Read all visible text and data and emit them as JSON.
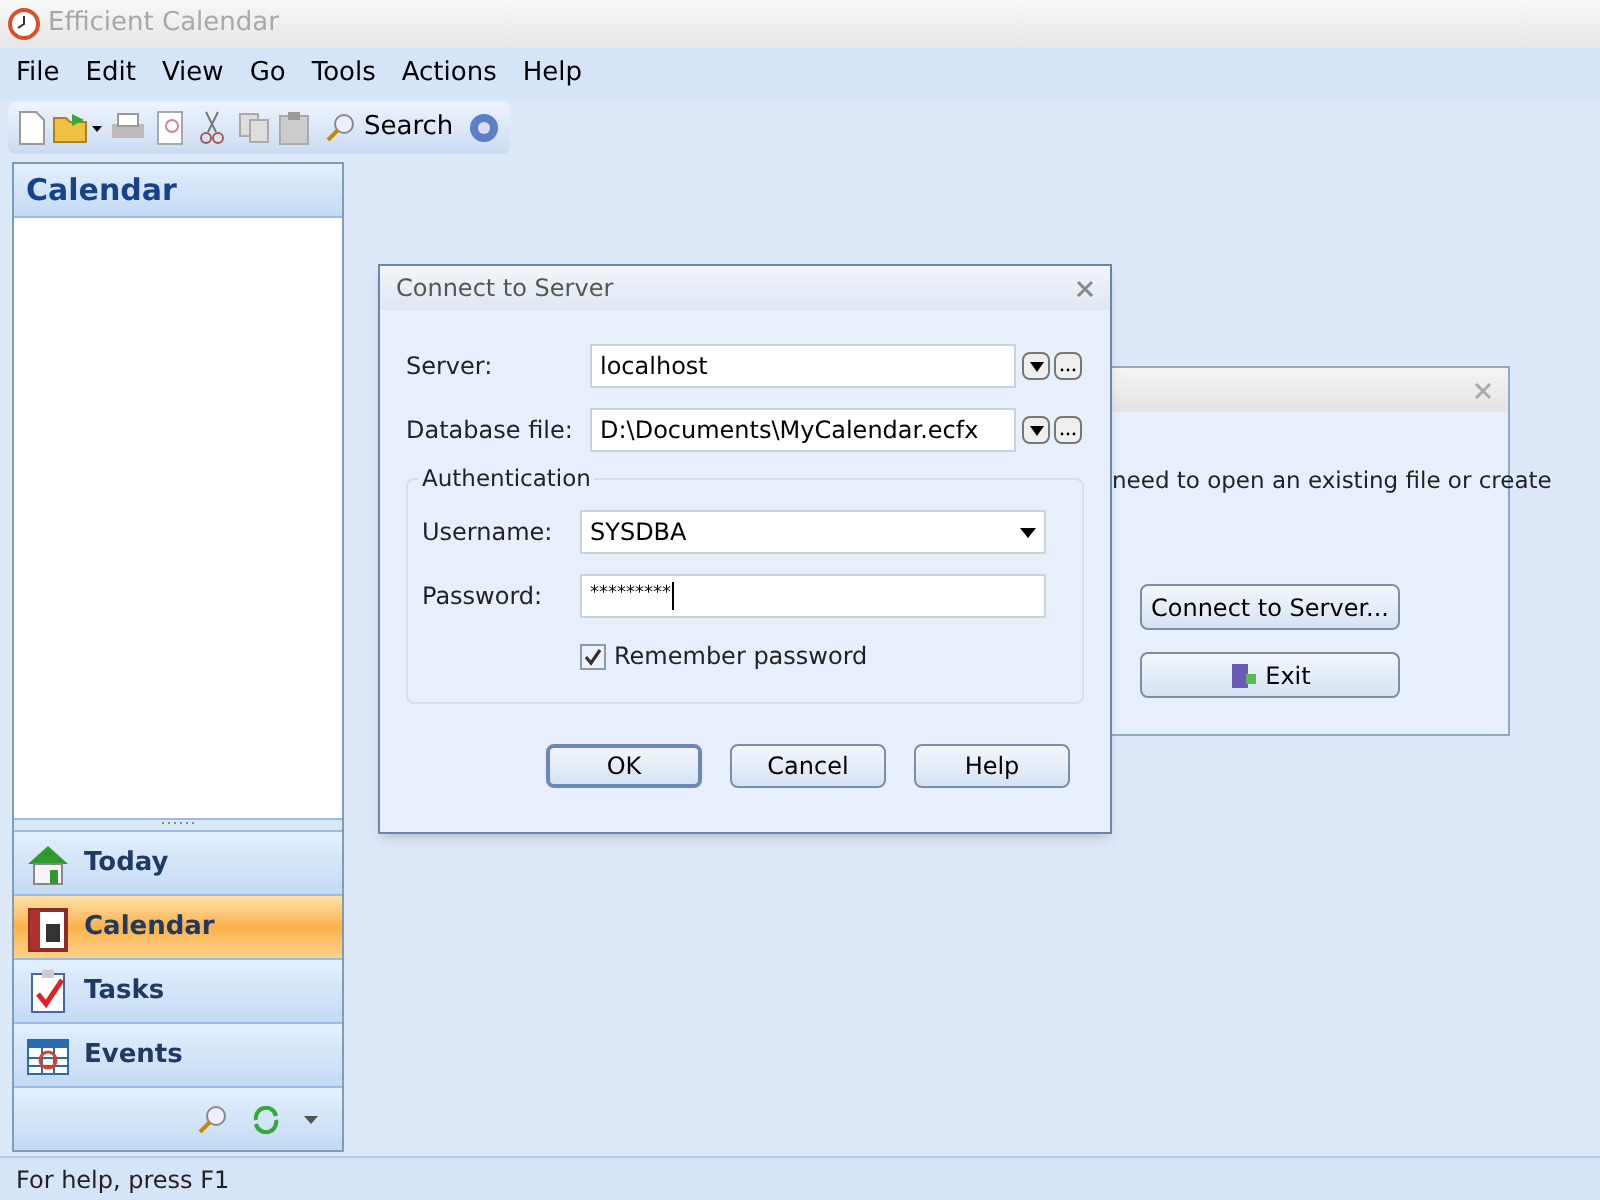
{
  "window": {
    "title": "Efficient Calendar"
  },
  "menu": [
    "File",
    "Edit",
    "View",
    "Go",
    "Tools",
    "Actions",
    "Help"
  ],
  "toolbar": {
    "search_label": "Search"
  },
  "sidebar": {
    "title": "Calendar",
    "nav": [
      {
        "label": "Today",
        "kind": "today",
        "selected": false
      },
      {
        "label": "Calendar",
        "kind": "calendar",
        "selected": true
      },
      {
        "label": "Tasks",
        "kind": "tasks",
        "selected": false
      },
      {
        "label": "Events",
        "kind": "events",
        "selected": false
      }
    ]
  },
  "back_dialog": {
    "text": "need to open an existing file or create",
    "buttons": [
      {
        "label": "Connect to Server...",
        "kind": "plain"
      },
      {
        "label": "Exit",
        "kind": "exit"
      }
    ]
  },
  "dialog": {
    "title": "Connect to Server",
    "server": {
      "label": "Server:",
      "value": "localhost"
    },
    "database": {
      "label": "Database file:",
      "value": "D:\\Documents\\MyCalendar.ecfx"
    },
    "group": "Authentication",
    "username": {
      "label": "Username:",
      "value": "SYSDBA"
    },
    "password": {
      "label": "Password:",
      "value": "*********"
    },
    "remember": {
      "label": "Remember password",
      "checked": true
    },
    "buttons": [
      {
        "label": "OK",
        "default": true
      },
      {
        "label": "Cancel",
        "default": false
      },
      {
        "label": "Help",
        "default": false
      }
    ]
  },
  "status_bar": "For help, press F1"
}
